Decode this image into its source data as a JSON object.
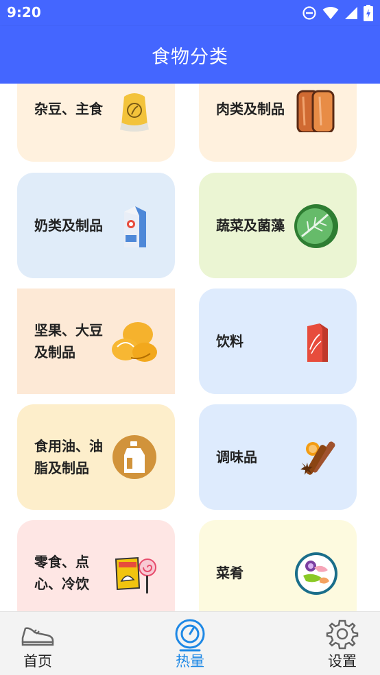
{
  "status_bar": {
    "time": "9:20",
    "icons": [
      "do-not-disturb-icon",
      "wifi-icon",
      "signal-icon",
      "battery-icon"
    ]
  },
  "app_bar": {
    "title": "食物分类"
  },
  "categories": [
    {
      "label": "杂豆、主食",
      "icon": "grain-sack-icon",
      "color": "#fff1de"
    },
    {
      "label": "肉类及制品",
      "icon": "sausage-icon",
      "color": "#fff1de"
    },
    {
      "label": "奶类及制品",
      "icon": "milk-carton-icon",
      "color": "#e0ecf9"
    },
    {
      "label": "蔬菜及菌藻",
      "icon": "cabbage-icon",
      "color": "#ebf5d3"
    },
    {
      "label": "坚果、大豆及制品",
      "icon": "nuts-icon",
      "color": "#fde9d6"
    },
    {
      "label": "饮料",
      "icon": "cola-can-icon",
      "color": "#deebfd"
    },
    {
      "label": "食用油、油脂及制品",
      "icon": "oil-bottle-icon",
      "color": "#fdeecb"
    },
    {
      "label": "调味品",
      "icon": "spices-icon",
      "color": "#deebfd"
    },
    {
      "label": "零食、点心、冷饮",
      "icon": "chips-lollipop-icon",
      "color": "#fee6e4"
    },
    {
      "label": "菜肴",
      "icon": "dish-plate-icon",
      "color": "#fdfadf"
    }
  ],
  "bottom_nav": [
    {
      "label": "首页",
      "icon": "sneaker-icon",
      "active": false
    },
    {
      "label": "热量",
      "icon": "scale-icon",
      "active": true
    },
    {
      "label": "设置",
      "icon": "gear-icon",
      "active": false
    }
  ],
  "colors": {
    "primary": "#4466ff",
    "active_nav": "#1e88e5"
  }
}
